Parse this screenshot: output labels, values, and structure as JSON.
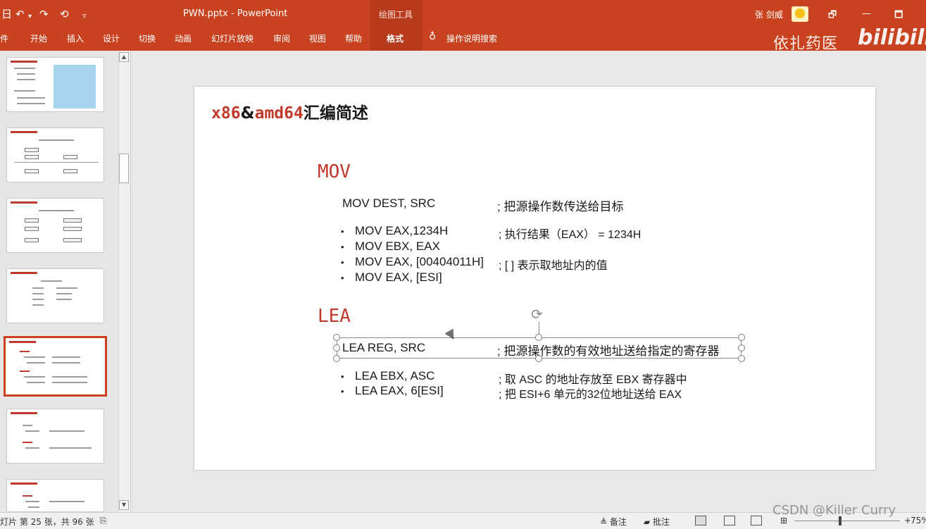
{
  "window": {
    "doc_title": "PWN.pptx  -  PowerPoint",
    "context_group": "绘图工具",
    "user": "张 剑威",
    "win_restore": "🗗",
    "win_min": "—",
    "win_max": "🗖"
  },
  "quick_access": {
    "save": "日",
    "undo": "↶",
    "undo_arrow": "▾",
    "redo": "↷",
    "present": "⟲",
    "custom": "▿"
  },
  "ribbon_tabs": [
    "件",
    "开始",
    "插入",
    "设计",
    "切换",
    "动画",
    "幻灯片放映",
    "审阅",
    "视图",
    "帮助",
    "格式"
  ],
  "tell_me": "操作说明搜索",
  "watermarks": {
    "channel": "依扎药医",
    "brand": "bilibili",
    "csdn": "CSDN @Killer Curry"
  },
  "slide": {
    "title_part1": "x86",
    "title_amp": "&",
    "title_part2": "amd64",
    "title_part3": "汇编简述",
    "mov": {
      "heading": "MOV",
      "syntax": "MOV DEST, SRC",
      "syntax_comment": "; 把源操作数传送给目标",
      "bullets": [
        {
          "code": "MOV EAX,1234H",
          "comment": "; 执行结果（EAX）  = 1234H"
        },
        {
          "code": "MOV EBX, EAX",
          "comment": ""
        },
        {
          "code": "MOV EAX, [00404011H]",
          "comment": "; [ ] 表示取地址内的值"
        },
        {
          "code": "MOV EAX, [ESI]",
          "comment": ""
        }
      ]
    },
    "lea": {
      "heading": "LEA",
      "syntax": "LEA REG, SRC",
      "syntax_comment": "; 把源操作数的有效地址送给指定的寄存器",
      "bullets": [
        {
          "code": "LEA EBX, ASC",
          "comment": "; 取 ASC 的地址存放至 EBX 寄存器中"
        },
        {
          "code": "LEA EAX, 6[ESI]",
          "comment": "; 把 ESI+6 单元的32位地址送给 EAX"
        }
      ]
    }
  },
  "status": {
    "slide_count": "灯片 第 25 张，共 96 张",
    "notes": "≜ 备注",
    "comments": "▰ 批注",
    "zoom": "75%",
    "zoom_plus": "+"
  },
  "thumbnails": {
    "count": 7,
    "selected_index": 4
  },
  "colors": {
    "ribbon": "#c8421f",
    "accent_red": "#c0392b"
  }
}
